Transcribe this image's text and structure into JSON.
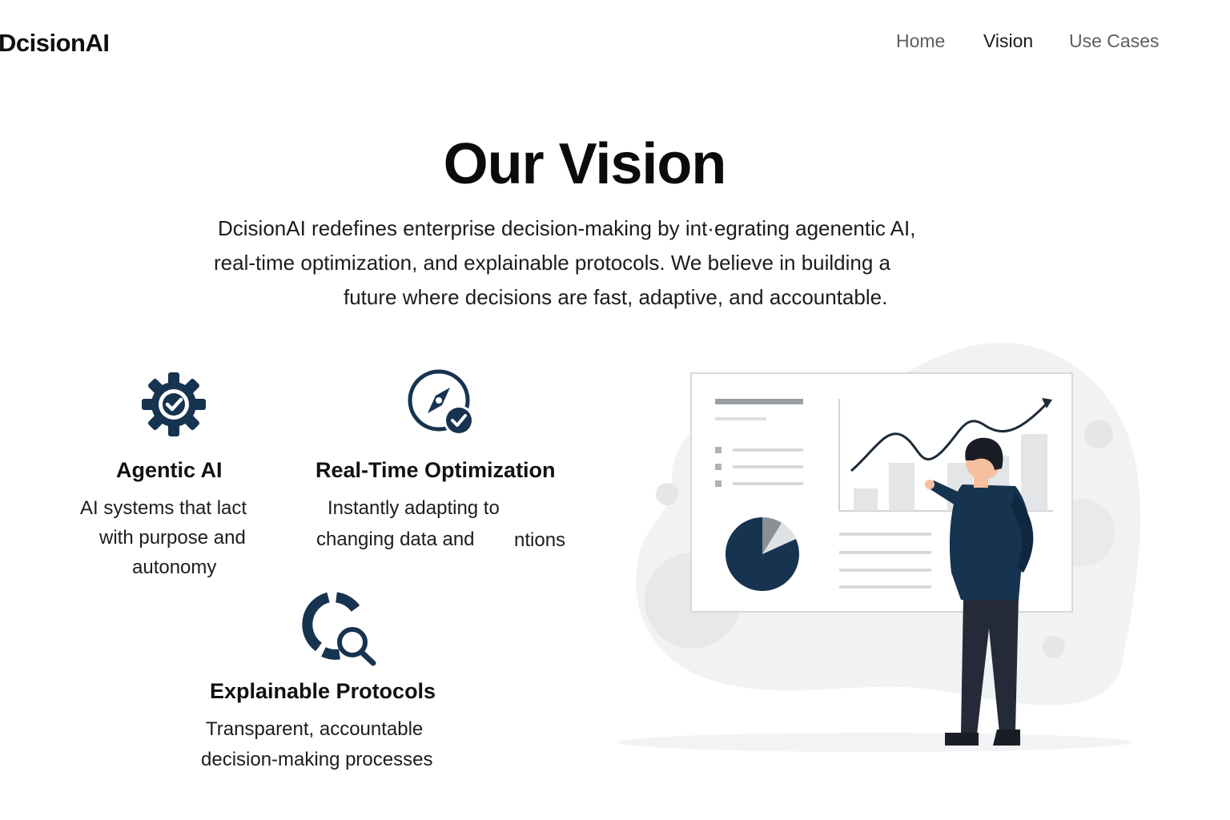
{
  "header": {
    "logo": "DcisionAI",
    "nav": [
      {
        "label": "Home",
        "active": false
      },
      {
        "label": "Vision",
        "active": true
      },
      {
        "label": "Use Cases",
        "active": false
      }
    ]
  },
  "hero": {
    "title": "Our Vision",
    "lines": [
      "DcisionAI redefines enterprise decision-making by int·egrating agenentic AI,",
      "real-time optimization, and explainable protocols. We believe in building a",
      "future where decisions are fast, adaptive, and accountable."
    ]
  },
  "features": [
    {
      "icon": "gear-check-icon",
      "title": "Agentic AI",
      "lines": [
        "AI systems that lact",
        "with purpose and",
        "autonomy"
      ]
    },
    {
      "icon": "compass-check-icon",
      "title": "Real-Time Optimization",
      "lines": [
        "Instantly adapting to",
        "changing data and",
        "ntions"
      ]
    },
    {
      "icon": "chart-magnifier-icon",
      "title": "Explainable Protocols",
      "lines": [
        "Transparent, accountable",
        "decision-making processes"
      ]
    }
  ],
  "illustration": {
    "icon": "person-presenting-dashboard-illustration"
  },
  "colors": {
    "navy": "#163350",
    "text": "#111111",
    "nav_inactive": "#5e5e5e",
    "blob": "#f1f2f3",
    "chart_gray": "#e3e5e7"
  }
}
